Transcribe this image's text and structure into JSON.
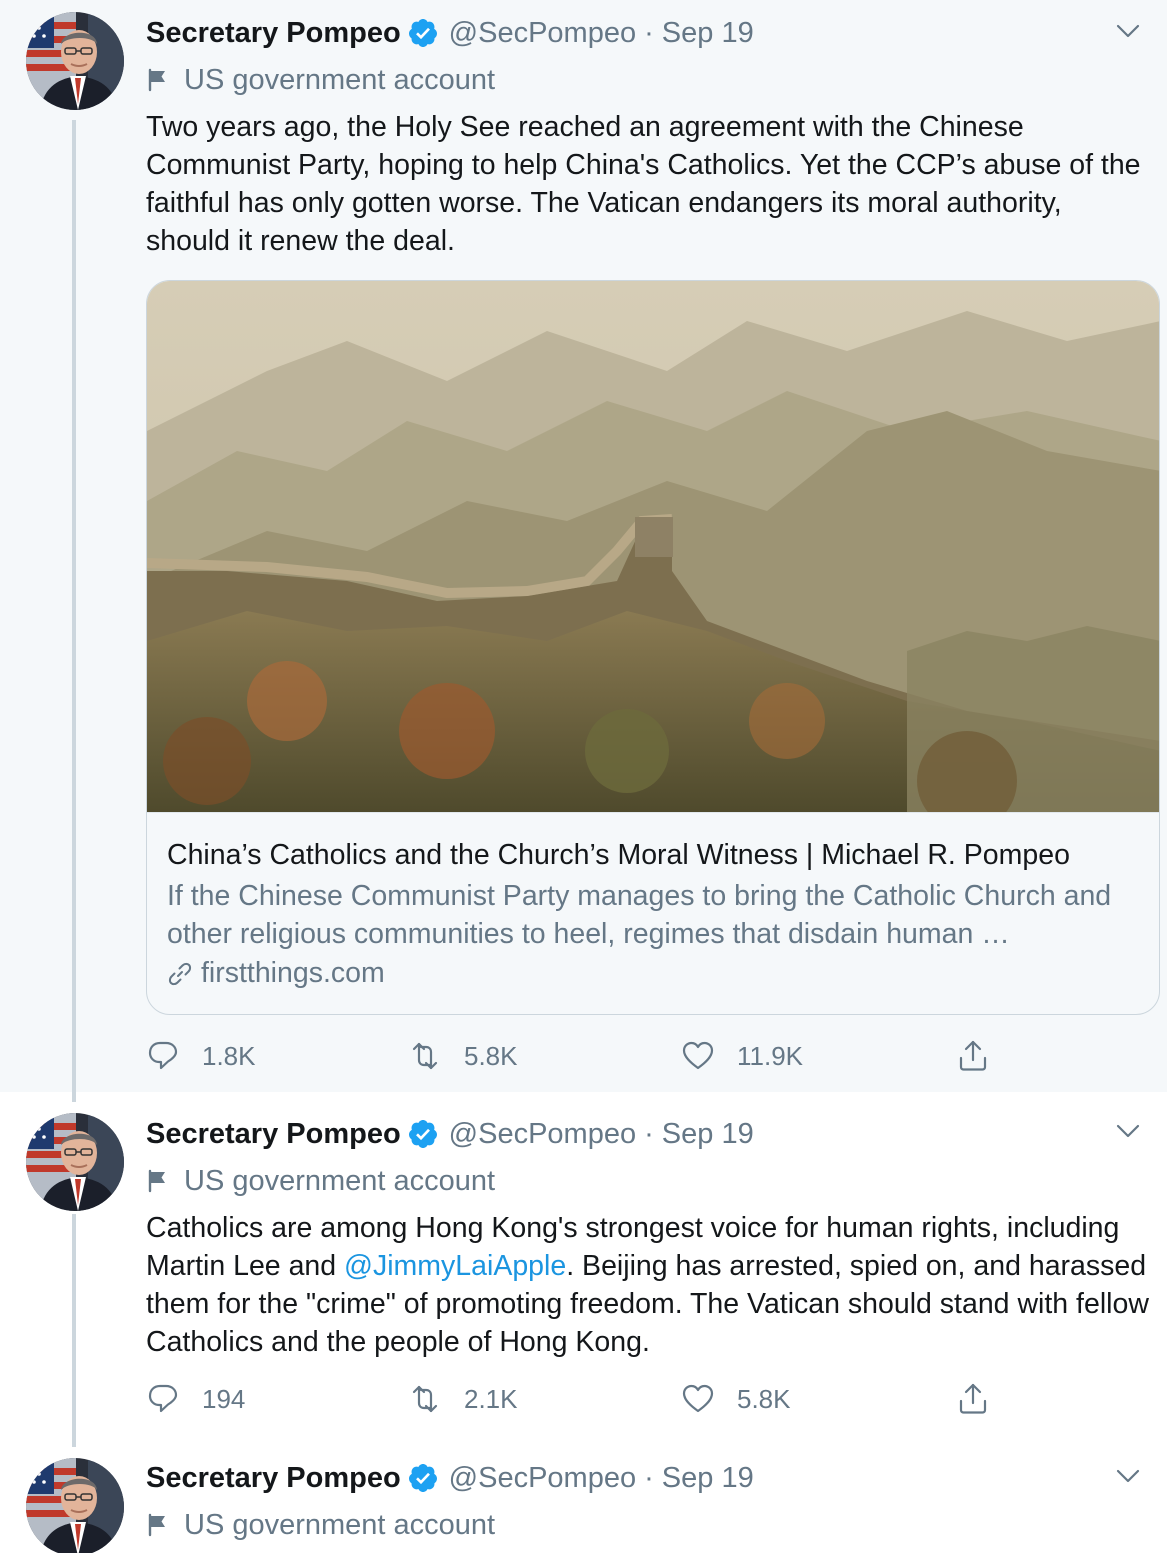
{
  "account": {
    "name": "Secretary Pompeo",
    "handle": "@SecPompeo",
    "separator": "·",
    "label": "US government account"
  },
  "tweets": [
    {
      "date": "Sep 19",
      "text": "Two years ago, the Holy See reached an agreement with the Chinese Communist Party, hoping to help China's Catholics. Yet the CCP’s abuse of the faithful has only gotten worse. The Vatican endangers its moral authority, should it renew the deal.",
      "card": {
        "title": "China’s Catholics and the Church’s Moral Witness | Michael R. Pompeo",
        "description": "If the Chinese Communist Party manages to bring the Catholic Church and other religious communities to heel, regimes that disdain human …",
        "domain": "firstthings.com",
        "image": "great-wall-mountains-photo"
      },
      "stats": {
        "replies": "1.8K",
        "retweets": "5.8K",
        "likes": "11.9K"
      }
    },
    {
      "date": "Sep 19",
      "text_before": "Catholics are among Hong Kong's strongest voice for human rights, including Martin Lee and ",
      "mention": "@JimmyLaiApple",
      "text_after": ". Beijing has arrested, spied on, and harassed them for the \"crime\" of promoting freedom. The Vatican should stand with fellow Catholics and the people of Hong Kong.",
      "stats": {
        "replies": "194",
        "retweets": "2.1K",
        "likes": "5.8K"
      }
    },
    {
      "date": "Sep 19"
    }
  ],
  "colors": {
    "verified": "#1da1f2",
    "link": "#1b95e0",
    "secondary_text": "#657786",
    "thread_line": "#ccd6dd",
    "highlight_bg": "#f5f8fa"
  },
  "icons": [
    "verified-badge-icon",
    "caret-down-icon",
    "flag-icon",
    "reply-icon",
    "retweet-icon",
    "like-icon",
    "share-icon",
    "link-icon"
  ]
}
